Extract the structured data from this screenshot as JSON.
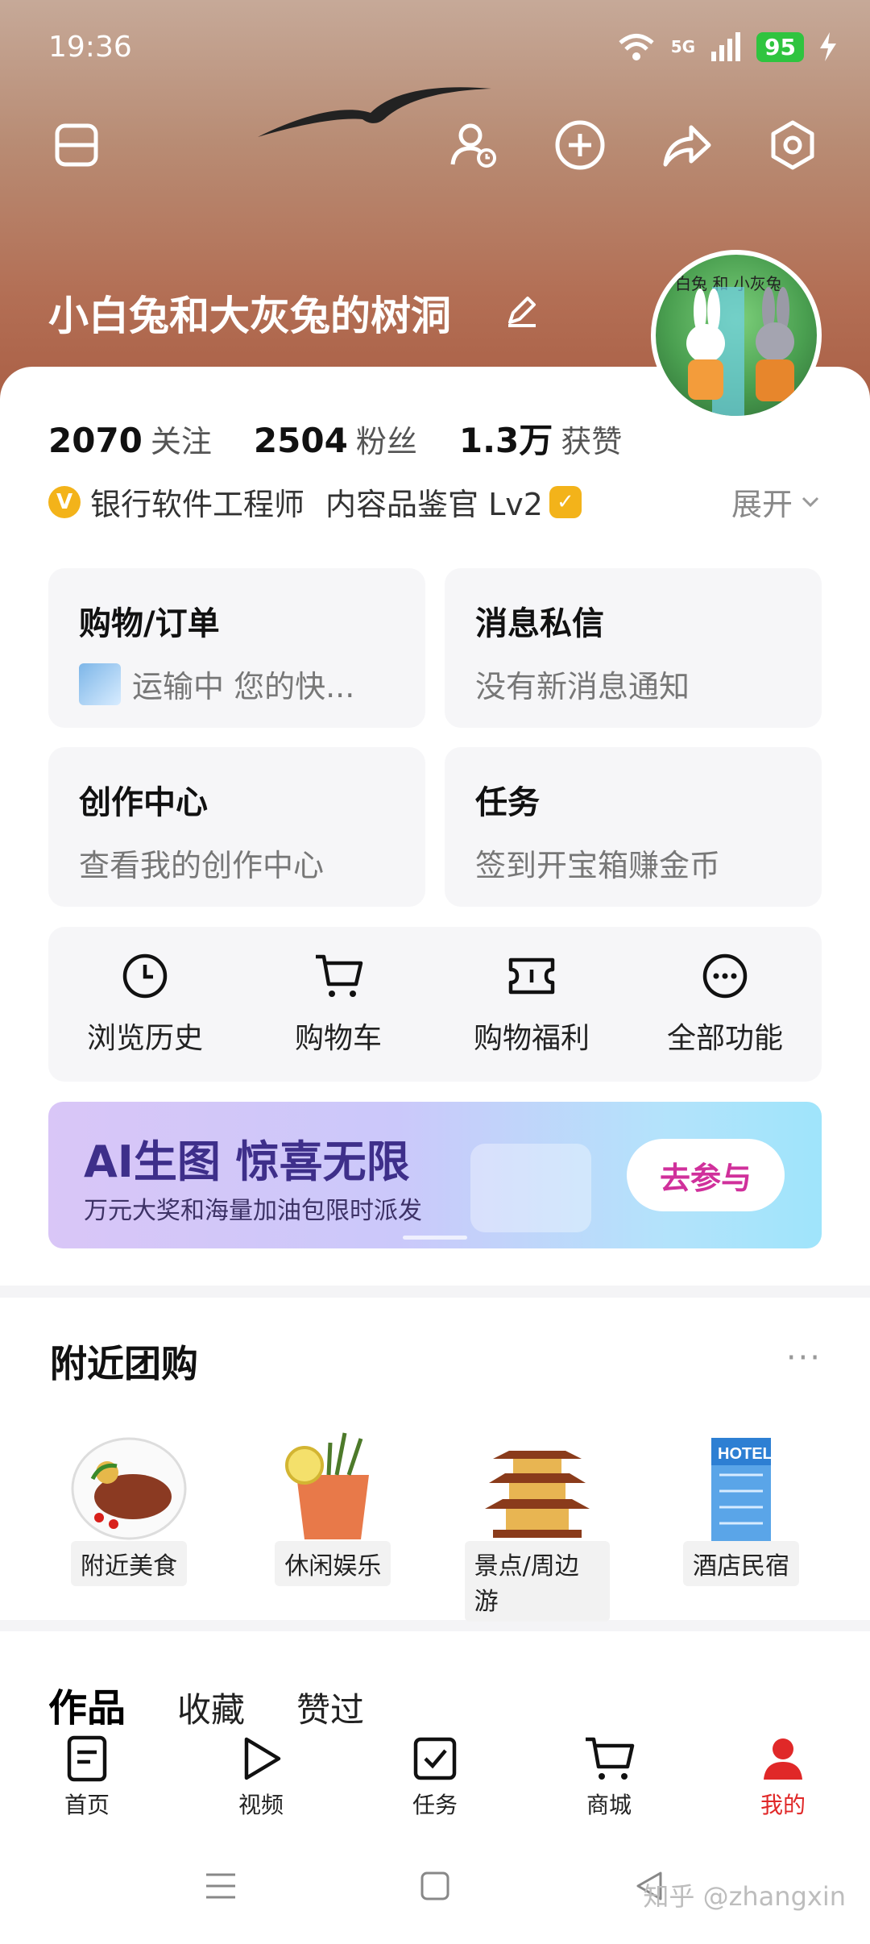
{
  "status": {
    "time": "19:36",
    "network": "5G",
    "battery": "95"
  },
  "profile": {
    "name": "小白兔和大灰兔的树洞",
    "avatar_text": "白兔 和 小灰兔",
    "stats": [
      {
        "num": "2070",
        "label": "关注"
      },
      {
        "num": "2504",
        "label": "粉丝"
      },
      {
        "num": "1.3万",
        "label": "获赞"
      }
    ],
    "badge_letter": "V",
    "tag1": "银行软件工程师",
    "tag2": "内容品鉴官 Lv2",
    "expand": "展开"
  },
  "tiles": [
    {
      "title": "购物/订单",
      "sub": "运输中 您的快..."
    },
    {
      "title": "消息私信",
      "sub": "没有新消息通知"
    },
    {
      "title": "创作中心",
      "sub": "查看我的创作中心"
    },
    {
      "title": "任务",
      "sub": "签到开宝箱赚金币"
    }
  ],
  "quick": [
    {
      "label": "浏览历史",
      "icon": "clock-icon"
    },
    {
      "label": "购物车",
      "icon": "cart-icon"
    },
    {
      "label": "购物福利",
      "icon": "ticket-icon"
    },
    {
      "label": "全部功能",
      "icon": "more-icon"
    }
  ],
  "banner": {
    "title": "AI生图 惊喜无限",
    "sub": "万元大奖和海量加油包限时派发",
    "cta": "去参与"
  },
  "nearby": {
    "title": "附近团购",
    "more": "···",
    "items": [
      {
        "label": "附近美食"
      },
      {
        "label": "休闲娱乐"
      },
      {
        "label": "景点/周边游"
      },
      {
        "label": "酒店民宿"
      }
    ]
  },
  "works_tabs": [
    "作品",
    "收藏",
    "赞过"
  ],
  "nav": [
    {
      "label": "首页"
    },
    {
      "label": "视频"
    },
    {
      "label": "任务"
    },
    {
      "label": "商城"
    },
    {
      "label": "我的"
    }
  ],
  "watermark": "知乎 @zhangxin",
  "hotel_sign": "HOTEL",
  "colors": {
    "accent": "#e02828",
    "gold": "#f3b31a",
    "cta": "#d0309b"
  }
}
